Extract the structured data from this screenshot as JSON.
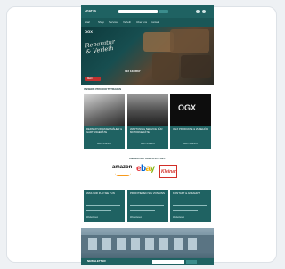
{
  "header": {
    "logo": "CRAFTS",
    "search_placeholder": "Suchen",
    "search_button": "Suchen"
  },
  "menu": [
    "Start",
    "Shop",
    "Service",
    "Verleih",
    "Über uns",
    "Kontakt"
  ],
  "hero": {
    "script_line1": "Reparatur",
    "script_line2": "& Verleih",
    "badge": "OGX",
    "phone": "022 1234567",
    "cta": "Mehr"
  },
  "products_section": {
    "title": "UNSERE PRODUKTSTRAßEN",
    "items": [
      {
        "title": "REPARATUR RASENMÄHER & GARTENGERÄTE",
        "link": "Mehr erfahren"
      },
      {
        "title": "WARTUNG & SERVICE FÜR MOTORGERÄTE",
        "link": "Mehr erfahren"
      },
      {
        "title": "OGX PRODUKTE & ZUBEHÖR",
        "link": "Mehr erfahren"
      }
    ]
  },
  "marketplaces": {
    "title": "FINDEN SIE UNS AUCH BEI:",
    "amazon": "amazon",
    "ebay": [
      "e",
      "b",
      "a",
      "y"
    ],
    "kleinanzeigen": "Kleinan"
  },
  "info_boxes": [
    {
      "title": "WAS WIR FÜR SIE TUN",
      "link": "Weiterlesen"
    },
    {
      "title": "PROFITIEREN SIE VON UNS",
      "link": "Weiterlesen"
    },
    {
      "title": "KONTAKT & ANFAHRT",
      "link": "Weiterlesen"
    }
  ],
  "footer": {
    "title": "NEWSLETTER",
    "input_placeholder": "E-Mail",
    "button": "OK"
  },
  "colors": {
    "primary": "#1f6262",
    "accent": "#c0312f"
  }
}
